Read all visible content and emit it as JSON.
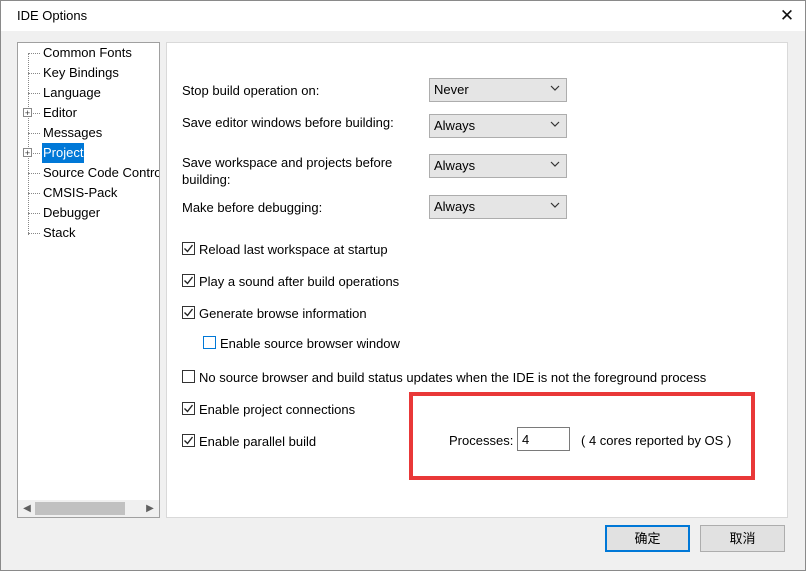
{
  "window": {
    "title": "IDE Options",
    "close_glyph": "✕"
  },
  "tree": {
    "items": [
      {
        "label": "Common Fonts",
        "expandable": false,
        "selected": false
      },
      {
        "label": "Key Bindings",
        "expandable": false,
        "selected": false
      },
      {
        "label": "Language",
        "expandable": false,
        "selected": false
      },
      {
        "label": "Editor",
        "expandable": true,
        "selected": false
      },
      {
        "label": "Messages",
        "expandable": false,
        "selected": false
      },
      {
        "label": "Project",
        "expandable": true,
        "selected": true
      },
      {
        "label": "Source Code Contro",
        "expandable": false,
        "selected": false
      },
      {
        "label": "CMSIS-Pack",
        "expandable": false,
        "selected": false
      },
      {
        "label": "Debugger",
        "expandable": false,
        "selected": false
      },
      {
        "label": "Stack",
        "expandable": false,
        "selected": false
      }
    ]
  },
  "settings": {
    "stop_build": {
      "label": "Stop build operation on:",
      "value": "Never"
    },
    "save_editor": {
      "label": "Save editor windows before building:",
      "value": "Always"
    },
    "save_workspace": {
      "label_line1": "Save workspace and projects before",
      "label_line2": "building:",
      "value": "Always"
    },
    "make_before_debug": {
      "label": "Make before debugging:",
      "value": "Always"
    }
  },
  "checkboxes": {
    "reload_workspace": {
      "label": "Reload last workspace at startup",
      "checked": true
    },
    "play_sound": {
      "label": "Play a sound after build operations",
      "checked": true
    },
    "generate_browse": {
      "label": "Generate browse information",
      "checked": true
    },
    "enable_source_browser": {
      "label": "Enable source browser window",
      "checked": false
    },
    "no_source_browser": {
      "label": "No source browser and build status updates when the IDE is not the foreground process",
      "checked": false
    },
    "project_connections": {
      "label": "Enable project connections",
      "checked": true
    },
    "parallel_build": {
      "label": "Enable parallel build",
      "checked": true
    }
  },
  "processes": {
    "label": "Processes:",
    "value": "4",
    "note": "( 4 cores reported by OS )"
  },
  "buttons": {
    "ok": "确定",
    "cancel": "取消"
  },
  "colors": {
    "selection": "#0078d7",
    "highlight_box": "#e93838"
  }
}
